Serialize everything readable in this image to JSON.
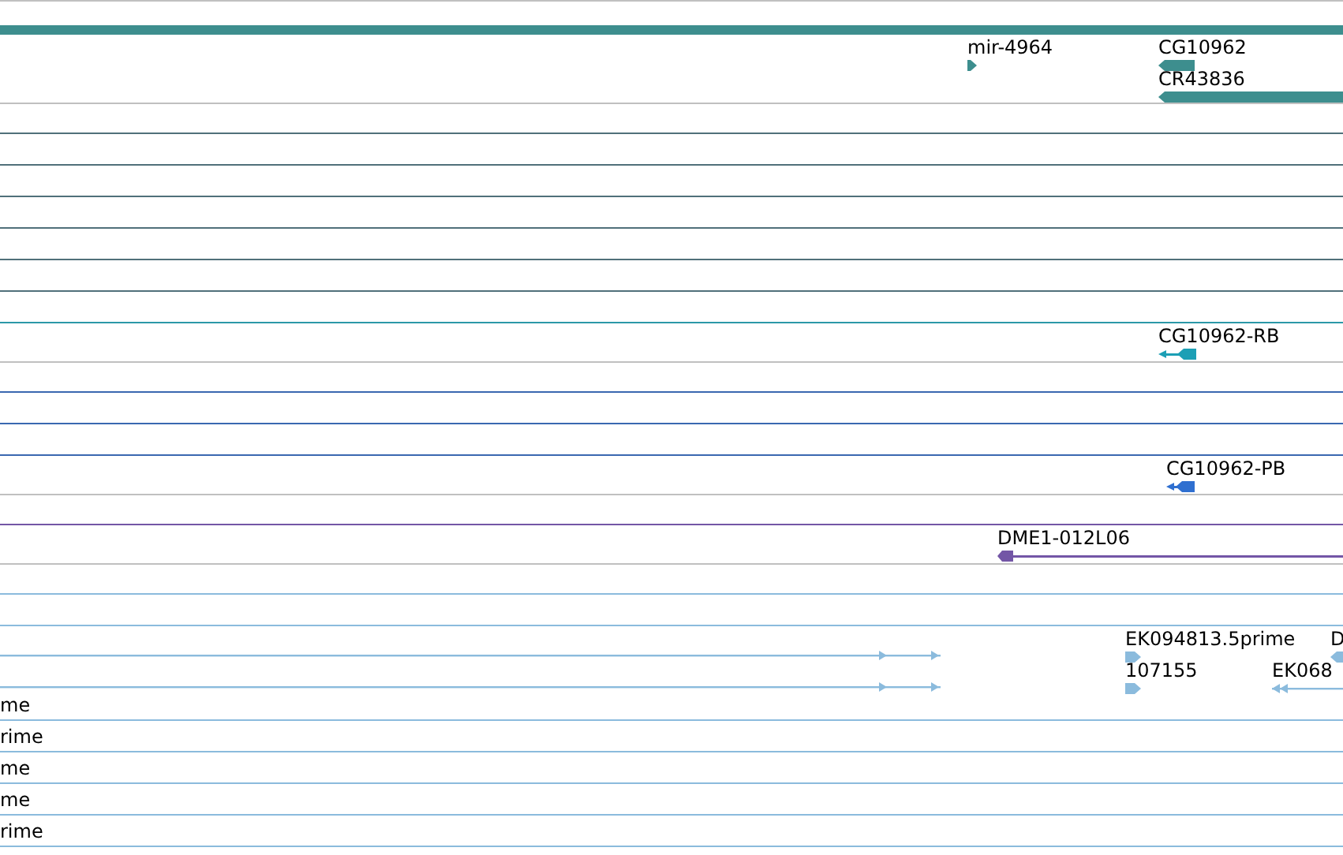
{
  "tracks": [
    {
      "color": "#c0c0c0",
      "features": [
        {
          "kind": "bar",
          "color": "#3d8e8e"
        },
        {
          "kind": "block",
          "label": "mir-4964",
          "color": "#3d8e8e",
          "reverse": false
        },
        {
          "kind": "block",
          "label": "CG10962",
          "color": "#3d8e8e",
          "reverse": true
        },
        {
          "kind": "block",
          "label": "CR43836",
          "color": "#3d8e8e",
          "reverse": true
        }
      ]
    },
    {
      "color": "#50707a"
    },
    {
      "color": "#50707a"
    },
    {
      "color": "#50707a"
    },
    {
      "color": "#50707a"
    },
    {
      "color": "#50707a"
    },
    {
      "color": "#50707a"
    },
    {
      "color": "#2b98a8"
    },
    {
      "color": "#c0c0c0",
      "features": [
        {
          "kind": "exons",
          "label": "CG10962-RB",
          "color": "#1c9fb5",
          "reverse": true
        }
      ]
    },
    {
      "color": "#3a68b0"
    },
    {
      "color": "#3a68b0"
    },
    {
      "color": "#3a68b0"
    },
    {
      "color": "#c0c0c0",
      "features": [
        {
          "kind": "exons",
          "label": "CG10962-PB",
          "color": "#2f6fd0",
          "reverse": true
        }
      ]
    },
    {
      "color": "#7356a6"
    },
    {
      "color": "#c0c0c0",
      "features": [
        {
          "kind": "tail",
          "label": "DME1-012L06",
          "color": "#7356a6",
          "reverse": true
        }
      ]
    },
    {
      "color": "#8bbbdd"
    },
    {
      "color": "#8bbbdd"
    },
    {
      "color": "#ffffff",
      "features": [
        {
          "kind": "span",
          "color": "#8bbbdd",
          "reverse": false
        },
        {
          "kind": "span",
          "color": "#8bbbdd",
          "reverse": false
        },
        {
          "kind": "block",
          "label": "EK094813.5prime",
          "color": "#8bbbdd",
          "reverse": false
        },
        {
          "kind": "block",
          "label": "D",
          "color": "#8bbbdd",
          "reverse": true
        },
        {
          "kind": "block",
          "label": "107155",
          "color": "#8bbbdd",
          "reverse": false
        },
        {
          "kind": "span",
          "label": "EK068",
          "color": "#8bbbdd",
          "reverse": true
        }
      ]
    },
    {
      "color": "#8bbbdd",
      "features": [
        {
          "kind": "text",
          "label": "me"
        }
      ]
    },
    {
      "color": "#8bbbdd",
      "features": [
        {
          "kind": "text",
          "label": "rime"
        }
      ]
    },
    {
      "color": "#8bbbdd",
      "features": [
        {
          "kind": "text",
          "label": "me"
        }
      ]
    },
    {
      "color": "#8bbbdd",
      "features": [
        {
          "kind": "text",
          "label": "me"
        }
      ]
    },
    {
      "color": "#8bbbdd",
      "features": [
        {
          "kind": "text",
          "label": "rime"
        }
      ]
    }
  ]
}
